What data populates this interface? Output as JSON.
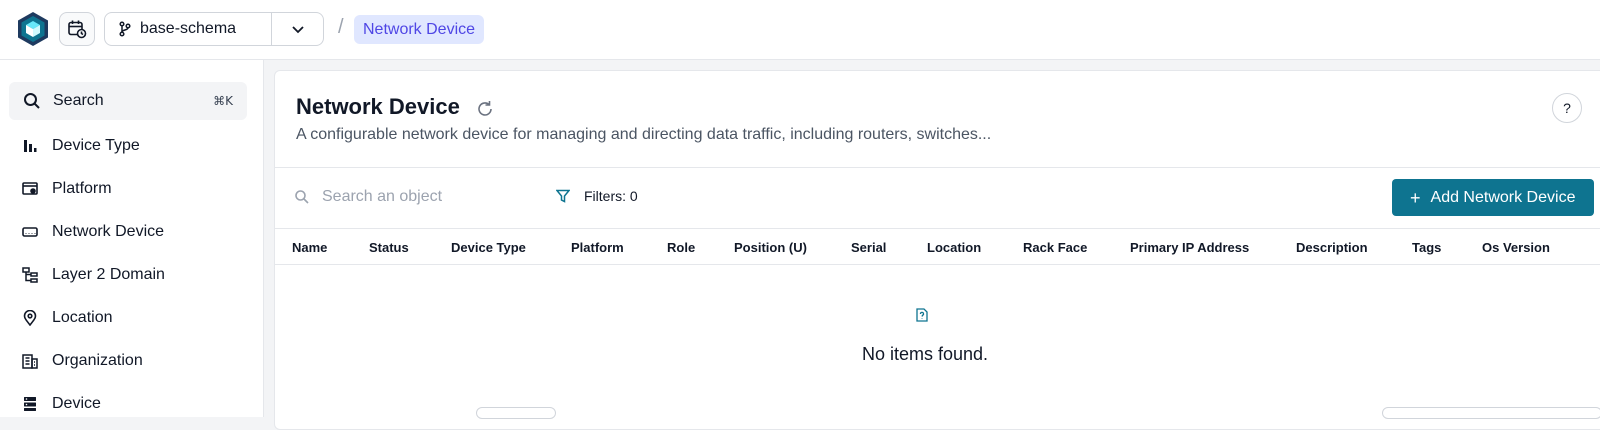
{
  "header": {
    "branch_name": "base-schema",
    "breadcrumb_sep": "/",
    "breadcrumb_current": "Network Device"
  },
  "sidebar": {
    "search_label": "Search",
    "search_shortcut": "⌘K",
    "items": [
      {
        "label": "Device Type",
        "icon": "bar-chart-icon"
      },
      {
        "label": "Platform",
        "icon": "platform-icon"
      },
      {
        "label": "Network Device",
        "icon": "router-icon"
      },
      {
        "label": "Layer 2 Domain",
        "icon": "network-tree-icon"
      },
      {
        "label": "Location",
        "icon": "location-pin-icon"
      },
      {
        "label": "Organization",
        "icon": "building-icon"
      },
      {
        "label": "Device",
        "icon": "server-icon"
      }
    ]
  },
  "main": {
    "title": "Network Device",
    "description": "A configurable network device for managing and directing data traffic, including routers, switches...",
    "help": "?",
    "search_placeholder": "Search an object",
    "filters_label": "Filters: 0",
    "add_button": "Add Network Device",
    "columns": [
      "Name",
      "Status",
      "Device Type",
      "Platform",
      "Role",
      "Position (U)",
      "Serial",
      "Location",
      "Rack Face",
      "Primary IP Address",
      "Description",
      "Tags",
      "Os Version"
    ],
    "empty_message": "No items found."
  },
  "colors": {
    "accent": "#0e7490",
    "breadcrumb_bg": "#e0e7ff",
    "breadcrumb_text": "#4f46e5"
  }
}
